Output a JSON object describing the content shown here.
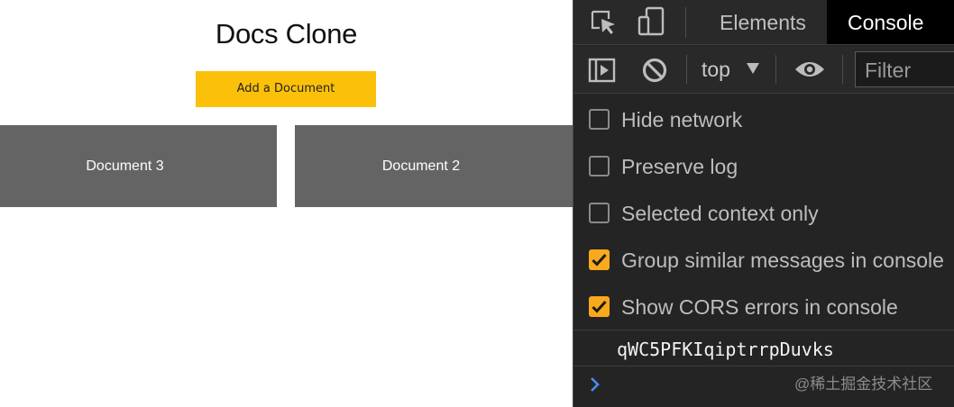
{
  "page": {
    "title": "Docs Clone",
    "add_button_label": "Add a Document",
    "documents": [
      {
        "label": "Document 3"
      },
      {
        "label": "Document 2"
      }
    ]
  },
  "devtools": {
    "tabs": [
      {
        "label": "Elements",
        "active": false
      },
      {
        "label": "Console",
        "active": true
      }
    ],
    "toolbar": {
      "context": "top",
      "filter_placeholder": "Filter"
    },
    "settings": [
      {
        "label": "Hide network",
        "checked": false
      },
      {
        "label": "Preserve log",
        "checked": false
      },
      {
        "label": "Selected context only",
        "checked": false
      },
      {
        "label": "Group similar messages in console",
        "checked": true
      },
      {
        "label": "Show CORS errors in console",
        "checked": true
      }
    ],
    "log_output": "qWC5PFKIqiptrrpDuvks",
    "watermark": "@稀土掘金技术社区"
  },
  "colors": {
    "accent_button": "#fbc10a",
    "doc_card": "#646464",
    "devtools_bg": "#242424",
    "checkbox_checked": "#f9a91c",
    "prompt_arrow": "#4a8bf5"
  },
  "icons": [
    "inspect-element-icon",
    "device-toggle-icon",
    "sidebar-toggle-icon",
    "clear-console-icon",
    "dropdown-caret-icon",
    "eye-icon",
    "checkmark-icon",
    "prompt-chevron-icon"
  ]
}
